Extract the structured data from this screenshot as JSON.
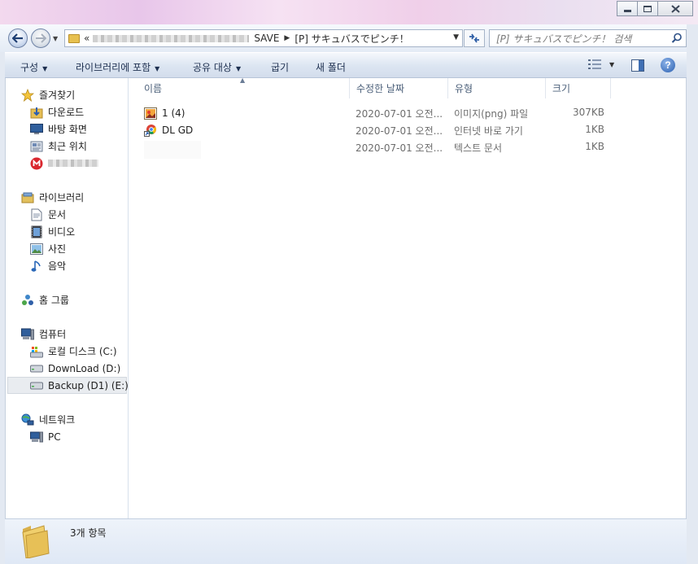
{
  "window": {
    "controls": {
      "minimize_icon": "minimize-icon",
      "maximize_icon": "maximize-icon",
      "close_icon": "close-icon"
    }
  },
  "address": {
    "chevrons": "«",
    "crumbs": [
      "SAVE",
      "[P] サキュバスでピンチ！"
    ],
    "search_placeholder": "[P] サキュバスでピンチ！ 검색"
  },
  "toolbar": {
    "organize": "구성",
    "include_library": "라이브러리에 포함",
    "share_with": "공유 대상",
    "burn": "굽기",
    "new_folder": "새 폴더"
  },
  "nav": {
    "favorites": {
      "label": "즐겨찾기",
      "items": [
        {
          "label": "다운로드",
          "icon": "download-folder-icon"
        },
        {
          "label": "바탕 화면",
          "icon": "desktop-icon"
        },
        {
          "label": "최근 위치",
          "icon": "recent-places-icon"
        }
      ]
    },
    "libraries": {
      "label": "라이브러리",
      "items": [
        {
          "label": "문서",
          "icon": "documents-icon"
        },
        {
          "label": "비디오",
          "icon": "videos-icon"
        },
        {
          "label": "사진",
          "icon": "pictures-icon"
        },
        {
          "label": "음악",
          "icon": "music-icon"
        }
      ]
    },
    "homegroup": {
      "label": "홈 그룹"
    },
    "computer": {
      "label": "컴퓨터",
      "items": [
        {
          "label": "로컬 디스크 (C:)",
          "icon": "local-disk-icon"
        },
        {
          "label": "DownLoad (D:)",
          "icon": "drive-icon"
        },
        {
          "label": "Backup (D1) (E:)",
          "icon": "drive-icon",
          "selected": true
        }
      ]
    },
    "network": {
      "label": "네트워크",
      "items": [
        {
          "label": "PC",
          "icon": "pc-icon"
        }
      ]
    }
  },
  "columns": {
    "name": "이름",
    "modified": "수정한 날짜",
    "type": "유형",
    "size": "크기"
  },
  "files": [
    {
      "name": "1 (4)",
      "modified": "2020-07-01 오전...",
      "type": "이미지(png) 파일",
      "size": "307KB",
      "icon": "png-image-icon"
    },
    {
      "name": "DL GD",
      "modified": "2020-07-01 오전...",
      "type": "인터넷 바로 가기",
      "size": "1KB",
      "icon": "internet-shortcut-icon"
    },
    {
      "name": "",
      "modified": "2020-07-01 오전...",
      "type": "텍스트 문서",
      "size": "1KB",
      "icon": ""
    }
  ],
  "status": {
    "item_count": "3개 항목"
  },
  "colors": {
    "accent": "#2a5fb0",
    "selection": "#e9ecf0",
    "header_text": "#4c607a"
  }
}
